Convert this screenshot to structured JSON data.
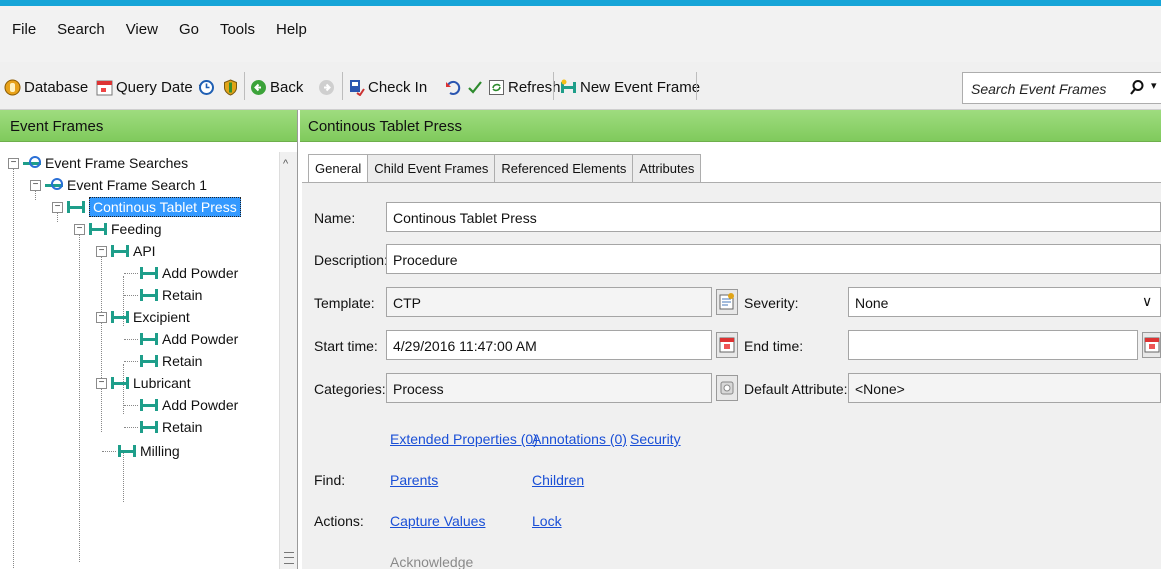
{
  "menu": [
    "File",
    "Search",
    "View",
    "Go",
    "Tools",
    "Help"
  ],
  "toolbar": {
    "database": "Database",
    "query_date": "Query Date",
    "back": "Back",
    "check_in": "Check In",
    "refresh": "Refresh",
    "new_event_frame": "New Event Frame",
    "search_placeholder": "Search Event Frames"
  },
  "left_pane": {
    "title": "Event Frames",
    "tree": [
      "Event Frame Searches",
      "Event Frame Search 1",
      "Continous Tablet Press",
      "Feeding",
      "API",
      "Add Powder",
      "Retain",
      "Excipient",
      "Add Powder",
      "Retain",
      "Lubricant",
      "Add Powder",
      "Retain",
      "Milling"
    ]
  },
  "right_pane": {
    "title": "Continous Tablet Press",
    "tabs": [
      "General",
      "Child Event Frames",
      "Referenced Elements",
      "Attributes"
    ],
    "general": {
      "name_label": "Name:",
      "name_value": "Continous Tablet Press",
      "description_label": "Description:",
      "description_value": "Procedure",
      "template_label": "Template:",
      "template_value": "CTP",
      "severity_label": "Severity:",
      "severity_value": "None",
      "start_time_label": "Start time:",
      "start_time_value": "4/29/2016 11:47:00 AM",
      "end_time_label": "End time:",
      "end_time_value": "",
      "categories_label": "Categories:",
      "categories_value": "Process",
      "default_attribute_label": "Default Attribute:",
      "default_attribute_value": "<None>",
      "extended_properties": "Extended Properties (0)",
      "annotations": "Annotations (0)",
      "security": "Security",
      "find_label": "Find:",
      "parents": "Parents",
      "children": "Children",
      "actions_label": "Actions:",
      "capture_values": "Capture Values",
      "lock": "Lock",
      "acknowledge": "Acknowledge"
    }
  },
  "colors": {
    "header_green": "#8fd46c",
    "selection_blue": "#3399ff",
    "link_blue": "#1a4fd6",
    "accent_line": "#17a5d8"
  }
}
